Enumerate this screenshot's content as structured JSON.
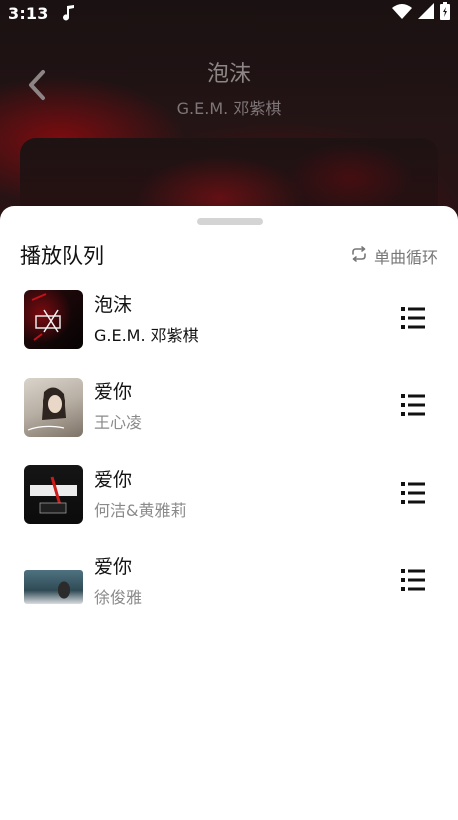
{
  "status_bar": {
    "time": "3:13"
  },
  "now_playing": {
    "title": "泡沫",
    "artist": "G.E.M. 邓紫棋"
  },
  "queue_sheet": {
    "title": "播放队列",
    "repeat_mode_label": "单曲循环",
    "items": [
      {
        "title": "泡沫",
        "artist": "G.E.M. 邓紫棋",
        "current": true
      },
      {
        "title": "爱你",
        "artist": "王心凌",
        "current": false
      },
      {
        "title": "爱你",
        "artist": "何洁&黄雅莉",
        "current": false
      },
      {
        "title": "爱你",
        "artist": "徐俊雅",
        "current": false
      }
    ]
  },
  "colors": {
    "accent_dark_red": "#7a0a10",
    "text_primary": "#111111",
    "text_secondary": "#8a8a8a"
  },
  "icons": {
    "status": [
      "music-note-icon",
      "wifi-icon",
      "cellular-signal-icon",
      "battery-icon"
    ],
    "back": "chevron-left-icon",
    "repeat": "repeat-one-icon",
    "item_menu": "list-menu-icon"
  }
}
